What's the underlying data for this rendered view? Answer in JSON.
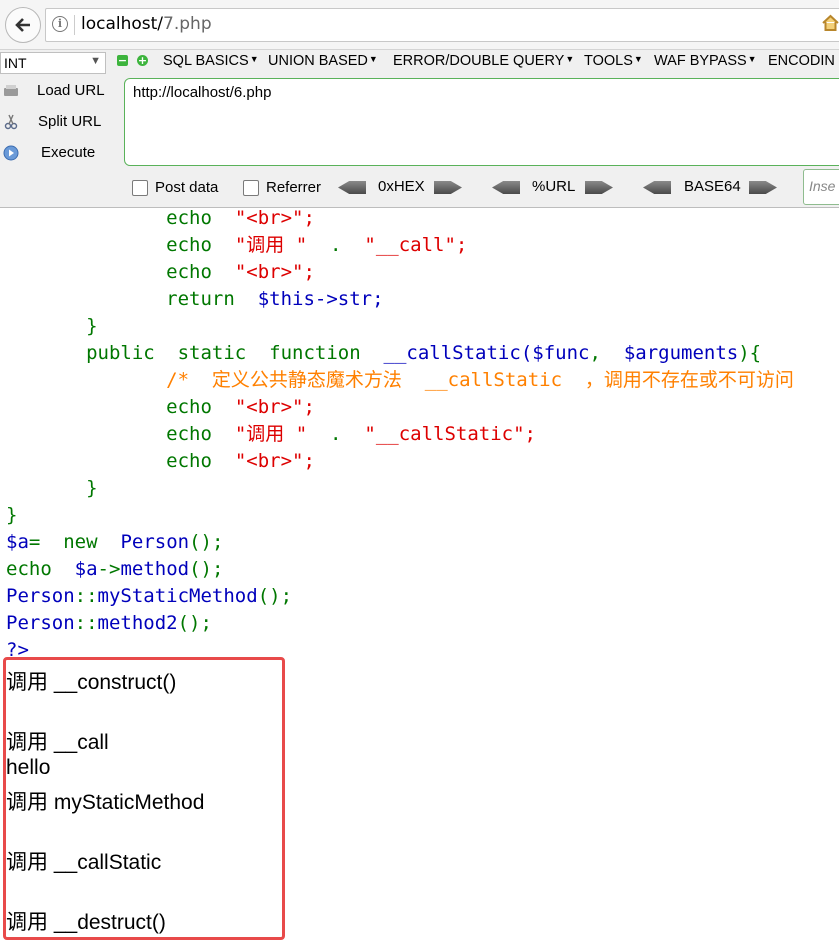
{
  "browser": {
    "url_host": "localhost/",
    "url_path": "7.php",
    "info_icon": "i"
  },
  "hackbar": {
    "type_select": "INT",
    "menus": [
      "SQL BASICS",
      "UNION BASED",
      "ERROR/DOUBLE QUERY",
      "TOOLS",
      "WAF BYPASS",
      "ENCODIN"
    ],
    "load_url": "Load URL",
    "split_url": "Split URL",
    "execute": "Execute",
    "url_value": "http://localhost/6.php",
    "post_data": "Post data",
    "referrer": "Referrer",
    "enc_hex": "0xHEX",
    "enc_url": "%URL",
    "enc_base64": "BASE64",
    "insert_placeholder": "Inse"
  },
  "code": {
    "l1": [
      "echo ",
      "\"<br>\";"
    ],
    "l2": [
      "echo ",
      "\"调用 \" ",
      ". ",
      "\"__call\";"
    ],
    "l3": [
      "echo ",
      "\"<br>\";"
    ],
    "l4": [
      "return ",
      "$this->str;"
    ],
    "l5": "}",
    "l6": [
      "public ",
      "static ",
      "function ",
      "__callStatic(",
      "$func",
      ", ",
      "$arguments",
      "){"
    ],
    "l7": "/*  定义公共静态魔术方法  __callStatic  ，调用不存在或不可访问",
    "l8": [
      "echo ",
      "\"<br>\";"
    ],
    "l9": [
      "echo ",
      "\"调用 \" ",
      ". ",
      "\"__callStatic\";"
    ],
    "l10": [
      "echo ",
      "\"<br>\";"
    ],
    "l11": "}",
    "l12": "}",
    "l13": [
      "$a",
      "= ",
      "new ",
      "Person",
      "();"
    ],
    "l14": [
      "echo ",
      "$a",
      "->",
      "method",
      "();"
    ],
    "l15": [
      "Person",
      "::",
      "myStaticMethod",
      "();"
    ],
    "l16": [
      "Person",
      "::",
      "method2",
      "();"
    ],
    "l17": "?>"
  },
  "output": [
    "调用 __construct()",
    "调用 __call",
    "hello",
    "调用 myStaticMethod",
    "调用 __callStatic",
    "调用 __destruct()"
  ]
}
